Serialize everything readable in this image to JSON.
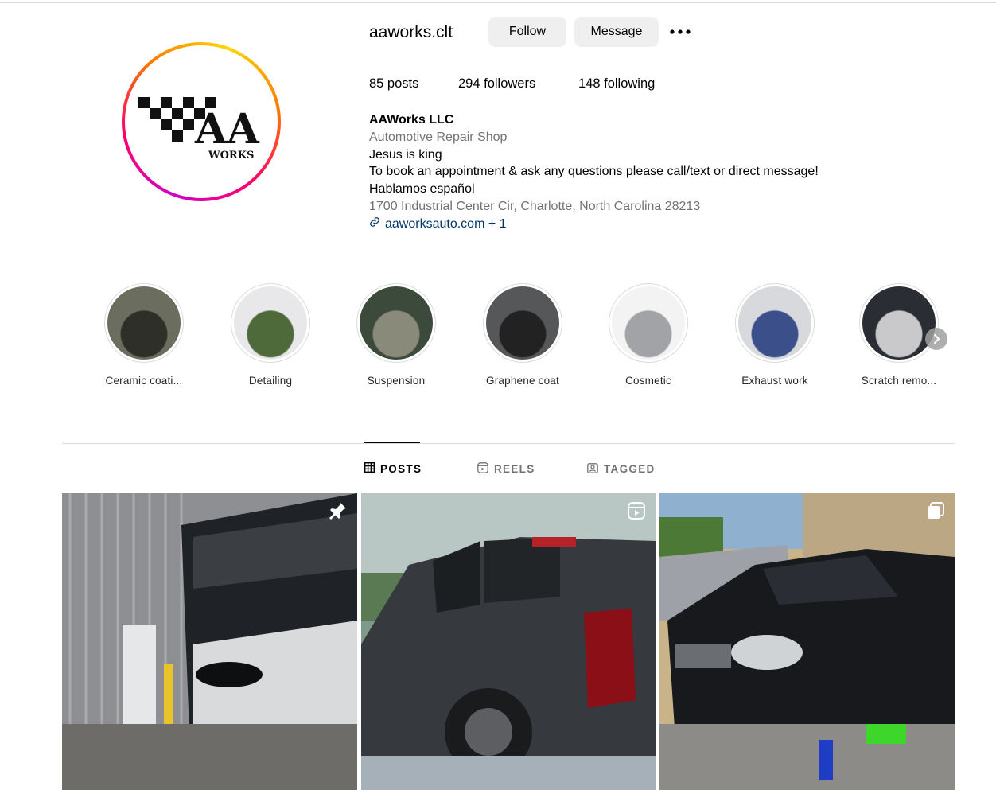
{
  "profile": {
    "username": "aaworks.clt",
    "follow_label": "Follow",
    "message_label": "Message",
    "logo_text": "AA",
    "logo_subtext": "WORKS"
  },
  "stats": {
    "posts": "85 posts",
    "followers": "294 followers",
    "following": "148 following"
  },
  "bio": {
    "name": "AAWorks LLC",
    "category": "Automotive Repair Shop",
    "line1": "Jesus is king",
    "line2": "To book an appointment & ask any questions please call/text or direct message!",
    "line3": "Hablamos español",
    "address": "1700 Industrial Center Cir, Charlotte, North Carolina 28213",
    "link": "aaworksauto.com + 1"
  },
  "highlights": [
    {
      "label": "Ceramic coati...",
      "colors": [
        "#6b6e5e",
        "#2d2f28"
      ]
    },
    {
      "label": "Detailing",
      "colors": [
        "#e8e8ea",
        "#4f6a3a"
      ]
    },
    {
      "label": "Suspension",
      "colors": [
        "#3c4a3c",
        "#8a8a7a"
      ]
    },
    {
      "label": "Graphene coat",
      "colors": [
        "#555759",
        "#222"
      ]
    },
    {
      "label": "Cosmetic",
      "colors": [
        "#f3f3f3",
        "#a1a3a6"
      ]
    },
    {
      "label": "Exhaust work",
      "colors": [
        "#d8d9dc",
        "#3b4f8a"
      ]
    },
    {
      "label": "Scratch remo...",
      "colors": [
        "#2a2d33",
        "#c9c9cc"
      ]
    }
  ],
  "tabs": {
    "posts": "POSTS",
    "reels": "REELS",
    "tagged": "TAGGED"
  },
  "posts": [
    {
      "kind": "pinned",
      "subject": "garage-building",
      "icon": "pin-icon"
    },
    {
      "kind": "reel",
      "subject": "gray-pickup-truck",
      "icon": "reel-icon"
    },
    {
      "kind": "carousel",
      "subject": "black-suv-repair",
      "icon": "carousel-icon"
    }
  ],
  "colors": {
    "link": "#00376b",
    "muted": "#737373",
    "button_bg": "#efefef",
    "divider": "#dbdbdb"
  }
}
